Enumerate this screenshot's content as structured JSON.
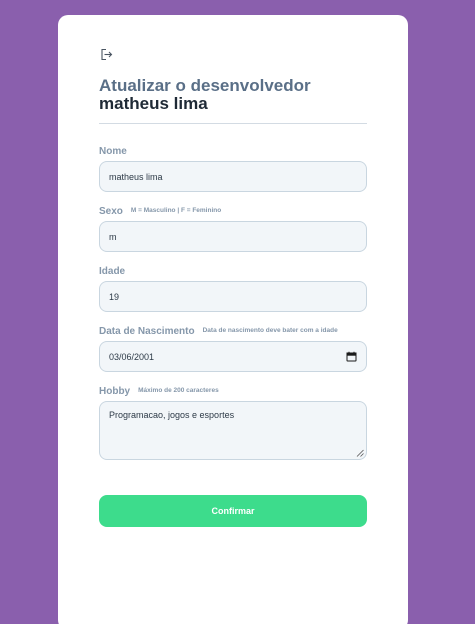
{
  "form": {
    "title_line1": "Atualizar o desenvolvedor",
    "title_line2": "matheus lima",
    "back_icon": "sign-in-icon",
    "fields": {
      "nome": {
        "label": "Nome",
        "value": "matheus lima"
      },
      "sexo": {
        "label": "Sexo",
        "hint": "M = Masculino | F = Feminino",
        "value": "m"
      },
      "idade": {
        "label": "Idade",
        "value": "19"
      },
      "nascimento": {
        "label": "Data de Nascimento",
        "hint": "Data de nascimento deve bater com a idade",
        "value": "03/06/2001",
        "icon": "calendar-icon"
      },
      "hobby": {
        "label": "Hobby",
        "hint": "Máximo de 200 caracteres",
        "value": "Programacao, jogos e esportes"
      }
    },
    "confirm_label": "Confirmar"
  },
  "colors": {
    "background": "#8a5fad",
    "card": "#ffffff",
    "accent_button": "#3ddc8c",
    "title_muted": "#5a6f87",
    "title_strong": "#1f2a36",
    "label": "#8597aa",
    "field_bg": "#f2f6f9",
    "field_border": "#c9d6e0"
  }
}
